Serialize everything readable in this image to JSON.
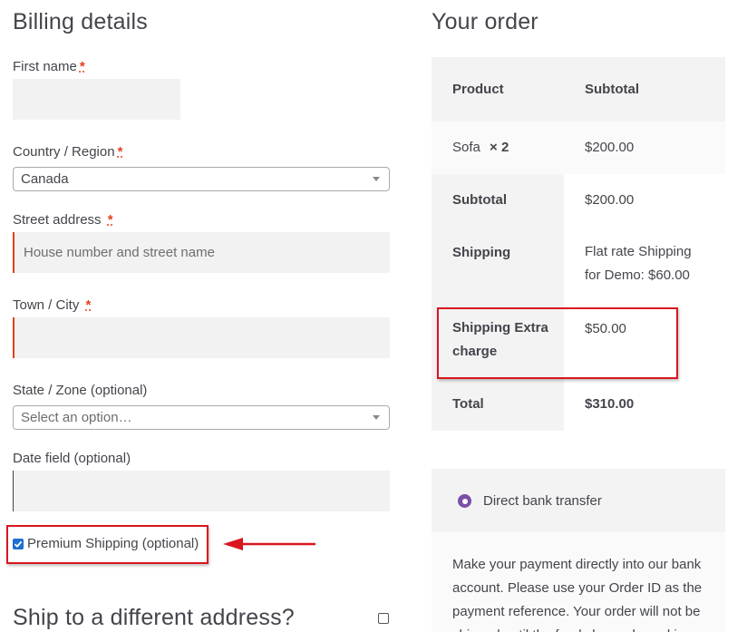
{
  "billing": {
    "heading": "Billing details",
    "first_name": {
      "label": "First name",
      "required": "*",
      "value": ""
    },
    "country": {
      "label": "Country / Region",
      "required": "*",
      "value": "Canada"
    },
    "street": {
      "label": "Street address",
      "required": "*",
      "placeholder": "House number and street name"
    },
    "town": {
      "label": "Town / City",
      "required": "*",
      "value": ""
    },
    "state": {
      "label": "State / Zone (optional)",
      "placeholder": "Select an option…"
    },
    "date": {
      "label": "Date field (optional)",
      "value": ""
    },
    "premium": {
      "label": "Premium Shipping (optional)",
      "checked": true
    },
    "ship_different": {
      "label": "Ship to a different address?",
      "checked": false
    }
  },
  "order": {
    "heading": "Your order",
    "col_product": "Product",
    "col_subtotal": "Subtotal",
    "item": {
      "name": "Sofa",
      "qty": "× 2",
      "price": "$200.00"
    },
    "subtotal": {
      "label": "Subtotal",
      "value": "$200.00"
    },
    "shipping": {
      "label": "Shipping",
      "value_line1": "Flat rate Shipping",
      "value_line2": "for Demo: $60.00"
    },
    "extra": {
      "label_line1": "Shipping Extra",
      "label_line2": "charge",
      "value": "$50.00"
    },
    "total": {
      "label": "Total",
      "value": "$310.00"
    }
  },
  "payment": {
    "method": "Direct bank transfer",
    "desc_lines": [
      "Make your payment directly into our bank",
      "account. Please use your Order ID as the",
      "payment reference. Your order will not be",
      "shipped until the funds have cleared in our"
    ]
  },
  "colors": {
    "accent_red": "#d9161f",
    "required_red": "#e2401c",
    "radio_purple": "#7b4fa8",
    "checkbox_blue": "#1f6fd1"
  }
}
